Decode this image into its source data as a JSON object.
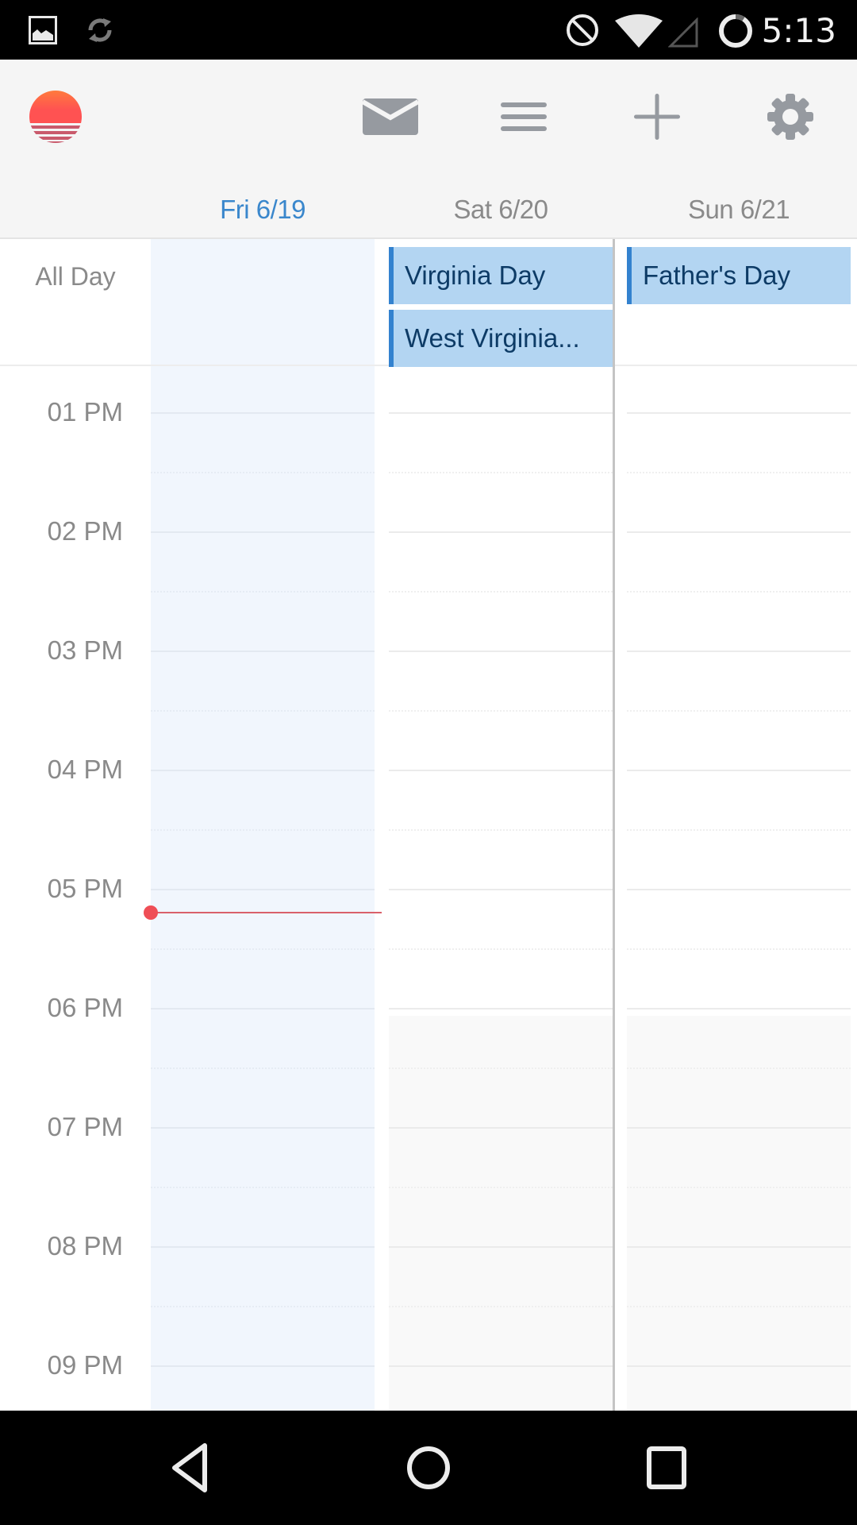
{
  "status_bar": {
    "time": "5:13",
    "left_icons": [
      "image-notification-icon",
      "sync-icon"
    ],
    "right_icons": [
      "do-not-disturb-icon",
      "wifi-icon",
      "cell-signal-icon",
      "battery-icon"
    ]
  },
  "toolbar": {
    "logo": "sunrise-logo",
    "actions": [
      {
        "name": "mail",
        "icon": "mail-icon"
      },
      {
        "name": "agenda",
        "icon": "menu-icon"
      },
      {
        "name": "new-event",
        "icon": "plus-icon"
      },
      {
        "name": "settings",
        "icon": "gear-icon"
      }
    ]
  },
  "days": [
    {
      "label": "Fri 6/19",
      "today": true
    },
    {
      "label": "Sat 6/20",
      "today": false
    },
    {
      "label": "Sun 6/21",
      "today": false
    }
  ],
  "all_day": {
    "label": "All Day",
    "events": [
      {
        "day": 1,
        "title": "Virginia Day"
      },
      {
        "day": 1,
        "title": "West Virginia..."
      },
      {
        "day": 2,
        "title": "Father's Day"
      }
    ]
  },
  "hours": [
    "01 PM",
    "02 PM",
    "03 PM",
    "04 PM",
    "05 PM",
    "06 PM",
    "07 PM",
    "08 PM",
    "09 PM"
  ],
  "now_indicator": {
    "time": "5:13",
    "color": "#ef4e56"
  },
  "colors": {
    "accent": "#3a87cc",
    "event_fill": "#b3d5f2",
    "event_bar": "#3382cf",
    "event_text": "#0d3b66",
    "today_column": "#f1f6fd"
  },
  "nav_bar": {
    "buttons": [
      "back-icon",
      "home-icon",
      "recents-icon"
    ]
  }
}
